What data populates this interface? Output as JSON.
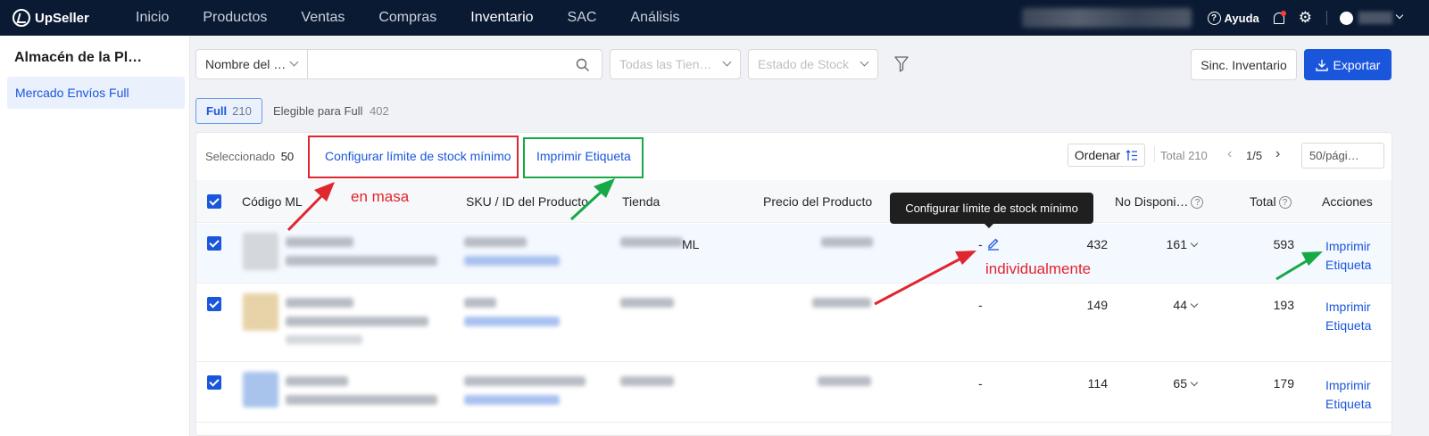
{
  "app": {
    "name": "UpSeller"
  },
  "nav": {
    "items": [
      "Inicio",
      "Productos",
      "Ventas",
      "Compras",
      "Inventario",
      "SAC",
      "Análisis"
    ],
    "active": "Inventario"
  },
  "header": {
    "help_label": "Ayuda"
  },
  "sidebar": {
    "title": "Almacén de la Pl…",
    "items": [
      {
        "label": "Mercado Envíos Full"
      }
    ]
  },
  "filters": {
    "search_field_select": "Nombre del …",
    "search_placeholder": "",
    "store_select": "Todas las Tien…",
    "stock_status_select": "Estado de Stock"
  },
  "actions": {
    "sync_label": "Sinc. Inventario",
    "export_label": "Exportar"
  },
  "tabs": [
    {
      "label": "Full",
      "count": "210"
    },
    {
      "label": "Elegible para Full",
      "count": "402"
    }
  ],
  "bulk": {
    "selected_label": "Seleccionado",
    "selected_count": "50",
    "set_min_stock": "Configurar límite de stock mínimo",
    "print_label": "Imprimir Etiqueta"
  },
  "pagination": {
    "order_label": "Ordenar",
    "total_label": "Total 210",
    "page": "1/5",
    "page_size": "50/pági…"
  },
  "table": {
    "columns": [
      "Código ML",
      "SKU / ID del Producto",
      "Tienda",
      "Precio del Producto",
      "No Disponi…",
      "Total",
      "Acciones"
    ],
    "rows": [
      {
        "store_suffix": "ML",
        "min_stock": "-",
        "available": "432",
        "unavailable": "161",
        "total": "593",
        "action": "Imprimir Etiqueta"
      },
      {
        "store_suffix": "",
        "min_stock": "-",
        "available": "149",
        "unavailable": "44",
        "total": "193",
        "action": "Imprimir Etiqueta"
      },
      {
        "store_suffix": "",
        "min_stock": "-",
        "available": "114",
        "unavailable": "65",
        "total": "179",
        "action": "Imprimir Etiqueta"
      }
    ]
  },
  "tooltip": {
    "text": "Configurar límite de stock mínimo"
  },
  "annotations": {
    "bulk_note": "en masa",
    "single_note": "individualmente",
    "red_color": "#e0262e",
    "green_color": "#17a847"
  },
  "colors": {
    "nav_bg": "#0b1a33",
    "primary": "#1a56db"
  }
}
